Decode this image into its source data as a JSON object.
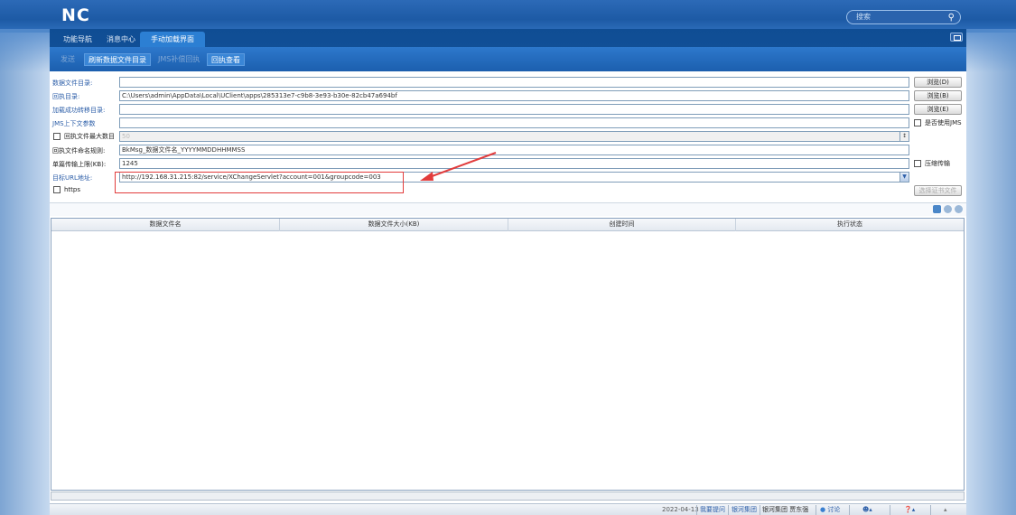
{
  "brand": {
    "logo": "NC"
  },
  "search": {
    "placeholder": "搜索"
  },
  "tabs": [
    {
      "label": "功能导航"
    },
    {
      "label": "消息中心"
    },
    {
      "label": "手动加载界面"
    }
  ],
  "toolbar": {
    "buttons": [
      {
        "label": "发送",
        "enabled": false
      },
      {
        "label": "刷新数据文件目录",
        "enabled": true
      },
      {
        "label": "JMS补偿回执",
        "enabled": false
      },
      {
        "label": "回执查看",
        "enabled": true
      }
    ]
  },
  "form": {
    "data_dir": {
      "label": "数据文件目录:",
      "value": "",
      "button": "浏览(D)"
    },
    "receipt_dir": {
      "label": "回执目录:",
      "value": "C:\\Users\\admin\\AppData\\Local\\UClient\\apps\\285313e7-c9b8-3e93-b30e-82cb47a694bf",
      "button": "浏览(B)"
    },
    "success_dir": {
      "label": "加载成功转移目录:",
      "value": "",
      "button": "浏览(E)"
    },
    "jms_params": {
      "label": "JMS上下文参数",
      "value": "",
      "checkbox": "是否使用JMS"
    },
    "max_receipt": {
      "label": "回执文件最大数目",
      "value": "50"
    },
    "receipt_naming": {
      "label": "回执文件命名规则:",
      "value": "BkMsg_数据文件名_YYYYMMDDHHMMSS"
    },
    "single_limit": {
      "label": "单篇传输上限(KB):",
      "value": "1245",
      "checkbox": "压缩传输"
    },
    "target_url": {
      "label": "目标URL地址:",
      "value": "http://192.168.31.215:82/service/XChangeServlet?account=001&groupcode=003"
    },
    "https": {
      "label": "https",
      "button": "选择证书文件"
    }
  },
  "grid": {
    "columns": [
      "数据文件名",
      "数据文件大小(KB)",
      "创建时间",
      "执行状态"
    ]
  },
  "status": {
    "date": "2022-04-13",
    "items": [
      "我要提问",
      "银河集团",
      "银河集团 贾东强"
    ],
    "discuss": "讨论"
  }
}
